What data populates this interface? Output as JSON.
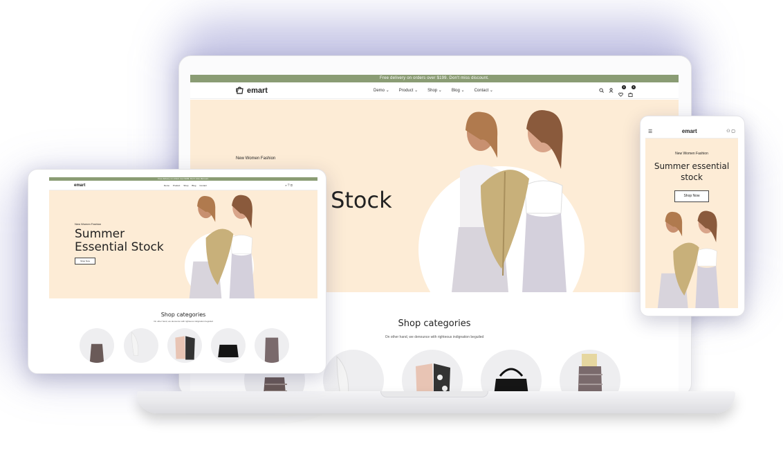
{
  "brand": {
    "name": "emart"
  },
  "promo_bar": {
    "text": "Free delivery on orders over $199. Don't miss discount."
  },
  "nav": {
    "items": [
      {
        "label": "Demo"
      },
      {
        "label": "Product"
      },
      {
        "label": "Shop"
      },
      {
        "label": "Blog"
      },
      {
        "label": "Contact"
      }
    ],
    "wishlist_count": "0",
    "cart_count": "0",
    "icons": [
      "search-icon",
      "user-icon",
      "heart-icon",
      "bag-icon",
      "chevron-down-icon",
      "menu-icon"
    ]
  },
  "hero": {
    "eyebrow": "New Women Fashion",
    "title_line1": "Summer",
    "title_line2": "Essential Stock",
    "title_partial": "l Stock",
    "mobile_title": "Summer essential stock",
    "cta_label": "Shop Now"
  },
  "categories": {
    "title": "Shop categories",
    "subtitle": "On other hand, we denounce with righteous indignation beguiled"
  },
  "colors": {
    "promo": "#8a9c74",
    "hero_bg": "#fdecd6",
    "text": "#222222"
  }
}
